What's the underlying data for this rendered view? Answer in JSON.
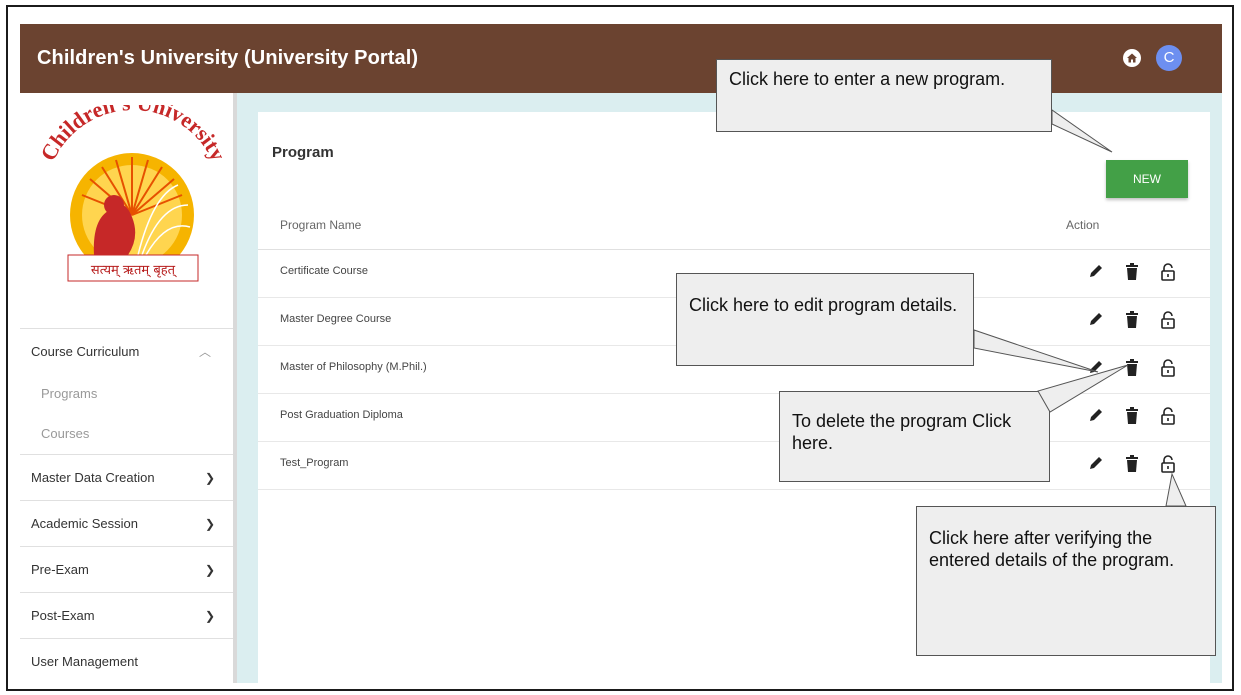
{
  "app": {
    "title": "Children's University (University Portal)",
    "avatar_letter": "C"
  },
  "logo": {
    "arc_text": "Children's University",
    "motto": "सत्यम् ऋतम् बृहत्"
  },
  "sidebar": {
    "items": [
      {
        "label": "Course Curriculum",
        "expanded": true,
        "sub": [
          "Programs",
          "Courses"
        ]
      },
      {
        "label": "Master Data Creation"
      },
      {
        "label": "Academic Session"
      },
      {
        "label": "Pre-Exam"
      },
      {
        "label": "Post-Exam"
      },
      {
        "label": "User Management"
      }
    ]
  },
  "page": {
    "title": "Program",
    "new_label": "NEW",
    "columns": {
      "name": "Program Name",
      "action": "Action"
    },
    "rows": [
      "Certificate Course",
      "Master Degree Course",
      "Master of Philosophy (M.Phil.)",
      "Post Graduation Diploma",
      "Test_Program"
    ]
  },
  "callouts": {
    "new": "Click here to enter a new program.",
    "edit": "Click here to edit program details.",
    "delete": "To delete the program Click here.",
    "verify": "Click here after verifying the entered details of the program."
  },
  "colors": {
    "appbar": "#6b4330",
    "new_button": "#43a047",
    "content_bg": "#dbeef0",
    "avatar": "#6d8ff0"
  }
}
